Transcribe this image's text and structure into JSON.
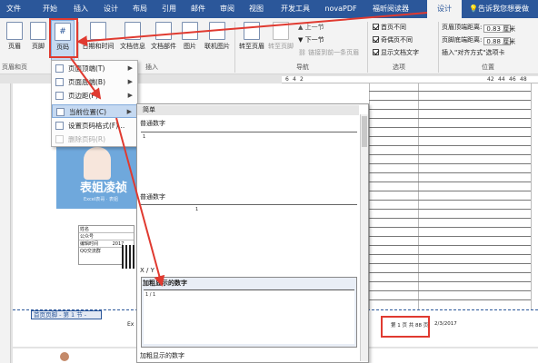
{
  "tabs": [
    "文件",
    "开始",
    "插入",
    "设计",
    "布局",
    "引用",
    "邮件",
    "审阅",
    "视图",
    "开发工具",
    "novaPDF",
    "福昕阅读器",
    "设计"
  ],
  "tell_me": "告诉我您想要做",
  "ribbon": {
    "header_btn": "页眉",
    "footer_btn": "页脚",
    "pagenum_btn": "页码",
    "datetime_btn": "日期和时间",
    "docinfo_btn": "文档信息",
    "docparts_btn": "文档部件",
    "picture_btn": "图片",
    "online_pic_btn": "联机图片",
    "goto_header_btn": "转至页眉",
    "goto_footer_btn": "转至页脚",
    "prev_btn": "上一节",
    "next_btn": "下一节",
    "link_prev_btn": "链接到前一条页眉",
    "opt_first": "首页不同",
    "opt_oddeven": "奇偶页不同",
    "opt_showtext": "显示文档文字",
    "header_dist_label": "页眉顶端距离:",
    "header_dist_value": "0.83 厘米",
    "footer_dist_label": "页脚底端距离:",
    "footer_dist_value": "0.88 厘米",
    "align_tab": "插入\"对齐方式\"选项卡",
    "group_hf": "页眉和页",
    "group_insert": "插入",
    "group_nav": "导航",
    "group_options": "选项",
    "group_position": "位置"
  },
  "menu": {
    "items": [
      "页面顶端(T)",
      "页面底端(B)",
      "页边距(P)",
      "当前位置(C)",
      "设置页码格式(F)...",
      "删除页码(R)"
    ]
  },
  "gallery": {
    "simple_header": "简单",
    "plain_number": "普通数字",
    "plain_number_2": "普通数字",
    "xy_header": "X / Y",
    "bold_number": "加粗显示的数字",
    "bold_number_2": "加粗显示的数字",
    "sample_1": "1",
    "sample_2": "1",
    "sample_3": "1 / 1"
  },
  "doc": {
    "cover_title": "表姐凌祯",
    "cover_sub": "Excel表哥 · 表姐",
    "footer_tag": "首页页脚 - 第 1 节 -",
    "page_marker": "第 1 页 共 88 页",
    "date_text": "2/3/2017",
    "footer_left": "Ex",
    "info_rows": [
      "姓名",
      "公众号",
      "编辑时间",
      "QQ交流群"
    ],
    "info_year": "2017"
  },
  "ruler": {
    "left_marks": [
      "6",
      "4",
      "2"
    ],
    "right_marks": [
      "42",
      "44",
      "46",
      "48"
    ]
  },
  "colors": {
    "ribbon_tab": "#2b579a",
    "annotation": "#e03a30",
    "menu_hl": "#c5d9f1",
    "cover": "#6fa8dc"
  }
}
